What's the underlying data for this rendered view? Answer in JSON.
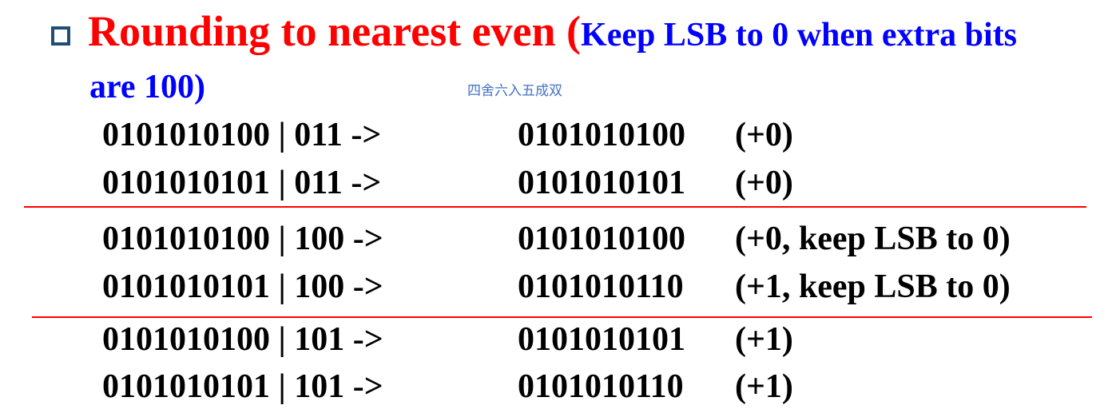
{
  "title": {
    "red_text": "Rounding to nearest even (",
    "blue_text_line1": "Keep LSB to 0 when extra bits",
    "blue_text_line2": "are 100)"
  },
  "note": "四舍六入五成双",
  "colors": {
    "bullet_border": "#1f4e79",
    "title_red": "#ff0000",
    "title_blue": "#0000ff",
    "note_blue": "#4472c4",
    "divider_red": "#ff0000"
  },
  "rows": [
    {
      "input": "0101010100 | 011 ->",
      "output": "0101010100",
      "delta": "(+0)"
    },
    {
      "input": "0101010101 | 011 ->",
      "output": "0101010101",
      "delta": "(+0)"
    },
    {
      "input": "0101010100 | 100 ->",
      "output": "0101010100",
      "delta": "(+0, keep LSB to 0)"
    },
    {
      "input": "0101010101 | 100 ->",
      "output": "0101010110",
      "delta": "(+1, keep LSB to 0)"
    },
    {
      "input": "0101010100 | 101 ->",
      "output": "0101010101",
      "delta": "(+1)"
    },
    {
      "input": "0101010101 | 101 ->",
      "output": "0101010110",
      "delta": "(+1)"
    }
  ]
}
